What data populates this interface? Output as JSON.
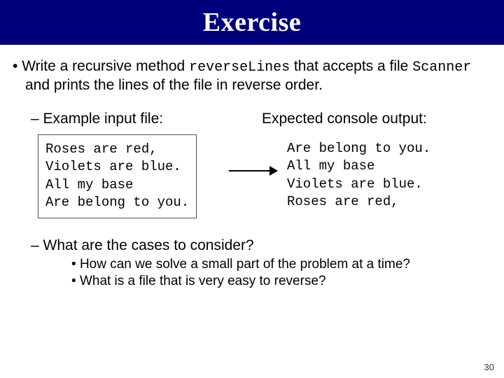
{
  "title": "Exercise",
  "bullet_lead": "Write a recursive method ",
  "method_name": "reverseLines",
  "bullet_mid": " that accepts a file ",
  "class_name": "Scanner",
  "bullet_tail": " and prints the lines of the file in reverse order.",
  "example_label": "Example input file:",
  "expected_label": "Expected console output:",
  "input_code": "Roses are red,\nViolets are blue.\nAll my base\nAre belong to you.",
  "output_code": "Are belong to you.\nAll my base\nViolets are blue.\nRoses are red,",
  "cases_question": "What are the cases to consider?",
  "subq1": "How can we solve a small part of the problem at a time?",
  "subq2": "What is a file that is very easy to reverse?",
  "page": "30"
}
